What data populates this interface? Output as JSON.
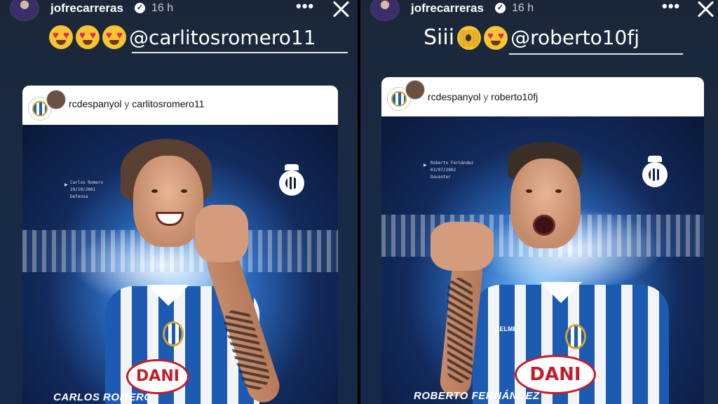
{
  "left_story": {
    "username": "jofrecarreras",
    "verified_icon": "verified-badge-icon",
    "time": "16 h",
    "more_label": "•••",
    "caption_emojis": [
      "heart-eyes-emoji",
      "heart-eyes-emoji",
      "heart-eyes-emoji"
    ],
    "mention": "@carlitosromero11",
    "card": {
      "account": "rcdespanyol",
      "conjunction": "y",
      "collaborator": "carlitosromero11",
      "poster": {
        "info_lines": [
          "Carlos Romero",
          "29/10/2001",
          "Defensa"
        ],
        "player_name": "CARLOS ROMERO",
        "sponsor": "DANI"
      }
    }
  },
  "right_story": {
    "username": "jofrecarreras",
    "verified_icon": "verified-badge-icon",
    "time": "16 h",
    "more_label": "•••",
    "caption_text": "Siii",
    "caption_emojis": [
      "face-with-peeking-eye-emoji",
      "heart-eyes-emoji"
    ],
    "mention": "@roberto10fj",
    "card": {
      "account": "rcdespanyol",
      "conjunction": "y",
      "collaborator": "roberto10fj",
      "poster": {
        "info_lines": [
          "Roberto Fernández",
          "03/07/2002",
          "Davanter"
        ],
        "player_name": "ROBERTO FERNÁNDEZ",
        "sponsor": "DANI",
        "kit_brand": "KELME"
      }
    }
  },
  "colors": {
    "background": "#1a2a44",
    "espanyol_blue": "#1d5bb3",
    "sponsor_red": "#c21d2a"
  }
}
